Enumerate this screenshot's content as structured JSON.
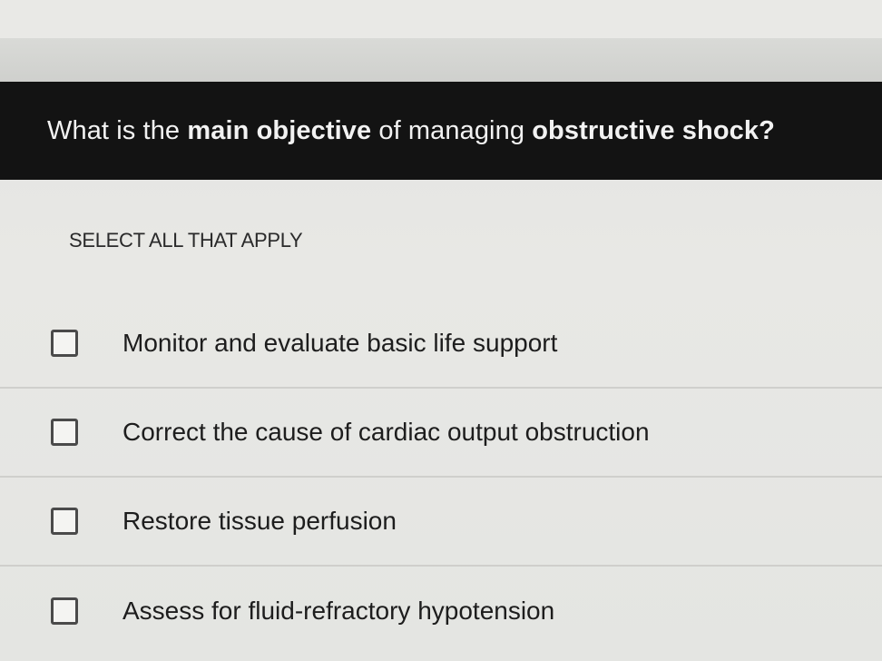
{
  "question": {
    "part1": "What is the ",
    "part2": "main objective",
    "part3": " of managing ",
    "part4": "obstructive shock?"
  },
  "instruction": "SELECT ALL THAT APPLY",
  "options": [
    {
      "label": "Monitor and evaluate basic life support",
      "checked": false
    },
    {
      "label": "Correct the cause of cardiac output obstruction",
      "checked": false
    },
    {
      "label": "Restore tissue perfusion",
      "checked": false
    },
    {
      "label": "Assess for fluid-refractory hypotension",
      "checked": false
    }
  ]
}
